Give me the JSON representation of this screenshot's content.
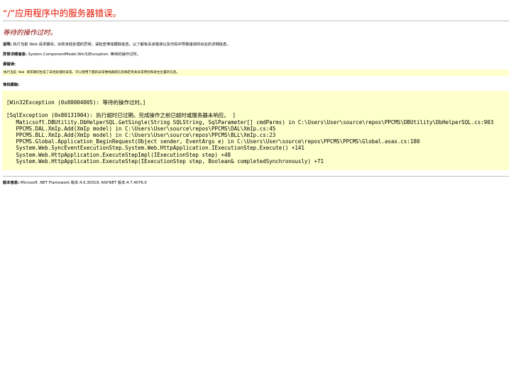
{
  "title": "“/”应用程序中的服务器错误。",
  "error_heading": "等待的操作过时。",
  "description": {
    "label": "说明:",
    "text": "执行当前 Web 请求期间，出现未经处理的异常。请检查堆栈跟踪信息，以了解有关该错误以及代码中导致错误的出处的详细信息。"
  },
  "exception_details": {
    "label": "异常详细信息:",
    "text": "System.ComponentModel.Win32Exception: 等待的操作过时。"
  },
  "source_error": {
    "label": "源错误:",
    "text": "执行当前 Web 请求期间生成了未经处理的异常。可以使用下面的异常堆栈跟踪信息确定有关异常原因和发生位置的信息。"
  },
  "stack_trace": {
    "label": "堆栈跟踪:",
    "lines": [
      "[Win32Exception (0x80004005): 等待的操作过时。]",
      "",
      "[SqlException (0x80131904): 执行超时已过期。完成操作之前已超时或服务器未响应。 ]",
      "   Maticsoft.DBUtility.DbHelperSQL.GetSingle(String SQLString, SqlParameter[] cmdParms) in C:\\Users\\User\\source\\repos\\PPCMS\\DBUtility\\DbHelperSQL.cs:903",
      "   PPCMS.DAL.XmIp.Add(XmIp model) in C:\\Users\\User\\source\\repos\\PPCMS\\DAL\\XmIp.cs:45",
      "   PPCMS.BLL.XmIp.Add(XmIp model) in C:\\Users\\User\\source\\repos\\PPCMS\\BLL\\XmIp.cs:23",
      "   PPCMS.Global.Application_BeginRequest(Object sender, EventArgs e) in C:\\Users\\User\\source\\repos\\PPCMS\\PPCMS\\Global.asax.cs:180",
      "   System.Web.SyncEventExecutionStep.System.Web.HttpApplication.IExecutionStep.Execute() +141",
      "   System.Web.HttpApplication.ExecuteStepImpl(IExecutionStep step) +48",
      "   System.Web.HttpApplication.ExecuteStep(IExecutionStep step, Boolean& completedSynchronously) +71"
    ]
  },
  "version_info": {
    "label": "版本信息:",
    "text": "Microsoft .NET Framework 版本:4.0.30319; ASP.NET 版本:4.7.4076.0"
  },
  "colors": {
    "title": "#e51400",
    "heading": "#8b0000",
    "highlight_bg": "#ffffcc"
  }
}
